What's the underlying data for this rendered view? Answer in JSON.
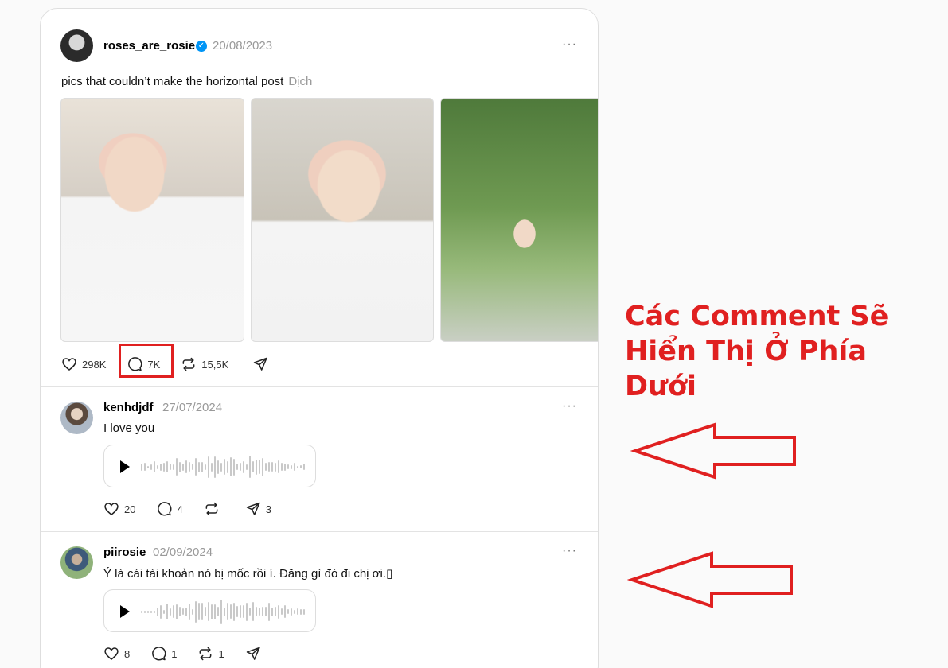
{
  "post": {
    "username": "roses_are_rosie",
    "date": "20/08/2023",
    "more_label": "···",
    "caption": "pics that couldn’t make the horizontal post",
    "translate_label": "Dịch",
    "likes": "298K",
    "comments": "7K",
    "reposts": "15,5K"
  },
  "comments": [
    {
      "username": "kenhdjdf",
      "date": "27/07/2024",
      "text": "I love you",
      "more_label": "···",
      "likes": "20",
      "replies": "4",
      "reposts": "",
      "shares": "3"
    },
    {
      "username": "piirosie",
      "date": "02/09/2024",
      "text": "Ý là cái tài khoản nó bị mốc rồi í. Đăng gì đó đi chị ơi.▯",
      "more_label": "···",
      "likes": "8",
      "replies": "1",
      "reposts": "1",
      "shares": ""
    }
  ],
  "annotation": {
    "line1": "Các Comment Sẽ",
    "line2": "Hiển Thị Ở Phía Dưới",
    "color": "#e02020"
  },
  "icons": [
    "heart-icon",
    "comment-icon",
    "repost-icon",
    "share-icon",
    "verified-icon",
    "play-icon",
    "more-icon"
  ]
}
